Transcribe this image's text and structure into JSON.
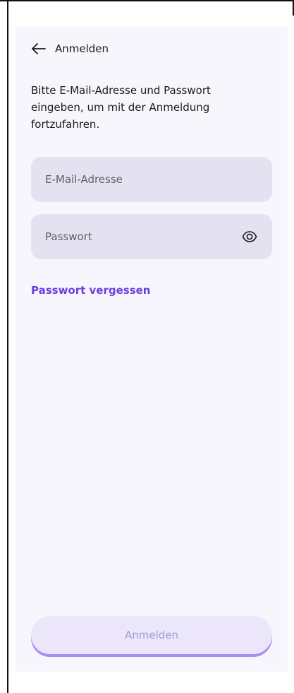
{
  "header": {
    "back_icon": "arrow-left-icon",
    "title": "Anmelden"
  },
  "intro_text": "Bitte E-Mail-Adresse und Passwort eingeben, um mit der Anmeldung fortzufahren.",
  "form": {
    "email": {
      "placeholder": "E-Mail-Adresse",
      "value": ""
    },
    "password": {
      "placeholder": "Passwort",
      "value": "",
      "toggle_icon": "eye-icon"
    },
    "forgot_link": "Passwort vergessen"
  },
  "actions": {
    "login_label": "Anmelden",
    "login_disabled": true
  },
  "colors": {
    "accent": "#6a3fe0",
    "field_bg": "#e4e2f1",
    "button_bg": "#ece6fb"
  }
}
